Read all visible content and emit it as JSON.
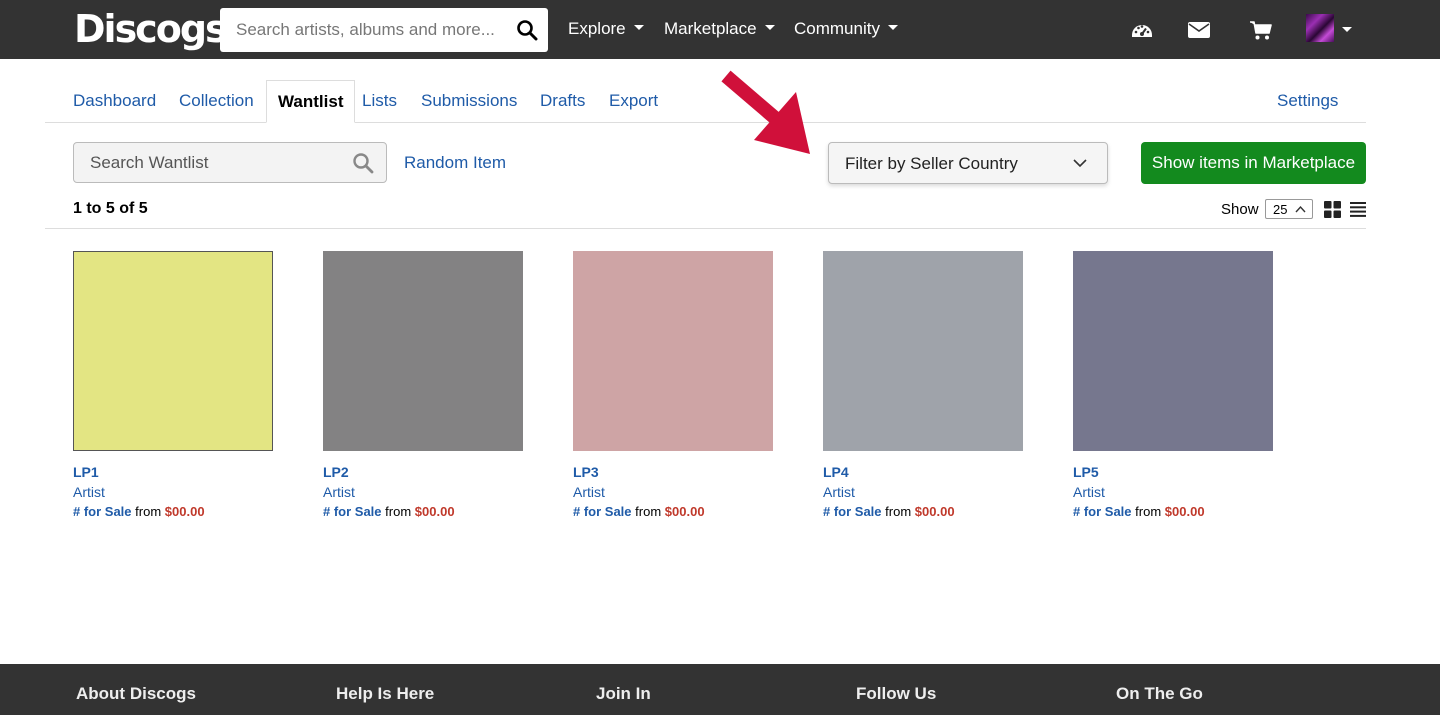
{
  "header": {
    "logo_text": "Discogs",
    "search_placeholder": "Search artists, albums and more...",
    "nav": [
      {
        "label": "Explore"
      },
      {
        "label": "Marketplace"
      },
      {
        "label": "Community"
      }
    ],
    "icons": [
      "dashboard-icon",
      "mail-icon",
      "cart-icon"
    ]
  },
  "tabs": {
    "items": [
      "Dashboard",
      "Collection",
      "Wantlist",
      "Lists",
      "Submissions",
      "Drafts",
      "Export"
    ],
    "active": "Wantlist",
    "settings": "Settings"
  },
  "toolbar": {
    "search_placeholder": "Search Wantlist",
    "random_item": "Random Item",
    "filter_label": "Filter by Seller Country",
    "marketplace_button": "Show items in Marketplace"
  },
  "results": {
    "count_text": "1 to 5 of 5",
    "show_label": "Show",
    "show_value": "25"
  },
  "items": [
    {
      "title": "LP1",
      "artist": "Artist",
      "for_sale": "# for Sale",
      "from": "from",
      "price": "$00.00",
      "cover_color": "#e3e583"
    },
    {
      "title": "LP2",
      "artist": "Artist",
      "for_sale": "# for Sale",
      "from": "from",
      "price": "$00.00",
      "cover_color": "#838283"
    },
    {
      "title": "LP3",
      "artist": "Artist",
      "for_sale": "# for Sale",
      "from": "from",
      "price": "$00.00",
      "cover_color": "#cea4a5"
    },
    {
      "title": "LP4",
      "artist": "Artist",
      "for_sale": "# for Sale",
      "from": "from",
      "price": "$00.00",
      "cover_color": "#9fa3aa"
    },
    {
      "title": "LP5",
      "artist": "Artist",
      "for_sale": "# for Sale",
      "from": "from",
      "price": "$00.00",
      "cover_color": "#76778e"
    }
  ],
  "footer": {
    "headings": [
      "About Discogs",
      "Help Is Here",
      "Join In",
      "Follow Us",
      "On The Go"
    ]
  },
  "colors": {
    "header_bg": "#333333",
    "link_blue": "#1f5ba8",
    "button_green": "#138a1e",
    "price_red": "#c0392b",
    "annotation_arrow": "#d0103a"
  }
}
